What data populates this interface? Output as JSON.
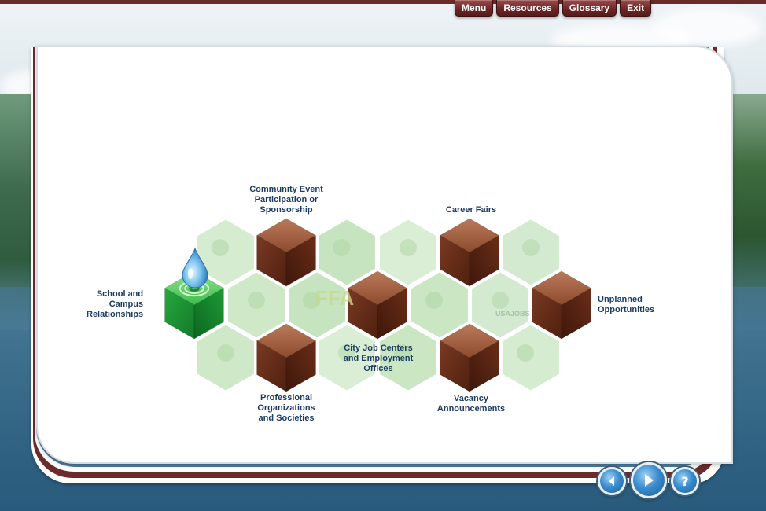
{
  "top_menu": {
    "menu": "Menu",
    "resources": "Resources",
    "glossary": "Glossary",
    "exit": "Exit"
  },
  "diagram": {
    "labels": {
      "school": "School and\nCampus\nRelationships",
      "community": "Community Event\nParticipation or\nSponsorship",
      "career": "Career Fairs",
      "unplanned": "Unplanned\nOpportunities",
      "cityjob": "City Job Centers\nand Employment\nOffices",
      "professional": "Professional\nOrganizations\nand Societies",
      "vacancy": "Vacancy\nAnnouncements"
    },
    "photo_text": {
      "ffa": "FFA",
      "usajobs": "USAJOBS"
    }
  },
  "colors": {
    "brand_maroon": "#6b2424",
    "label_blue": "#1e3d63",
    "cube_green": "#1c9a3c",
    "cube_brown": "#7a3a22",
    "hex_green": "#cfe8c8"
  },
  "nav": {
    "back_icon": "back-arrow-icon",
    "next_icon": "next-arrow-icon",
    "help_icon": "help-icon",
    "help_text": "?"
  }
}
